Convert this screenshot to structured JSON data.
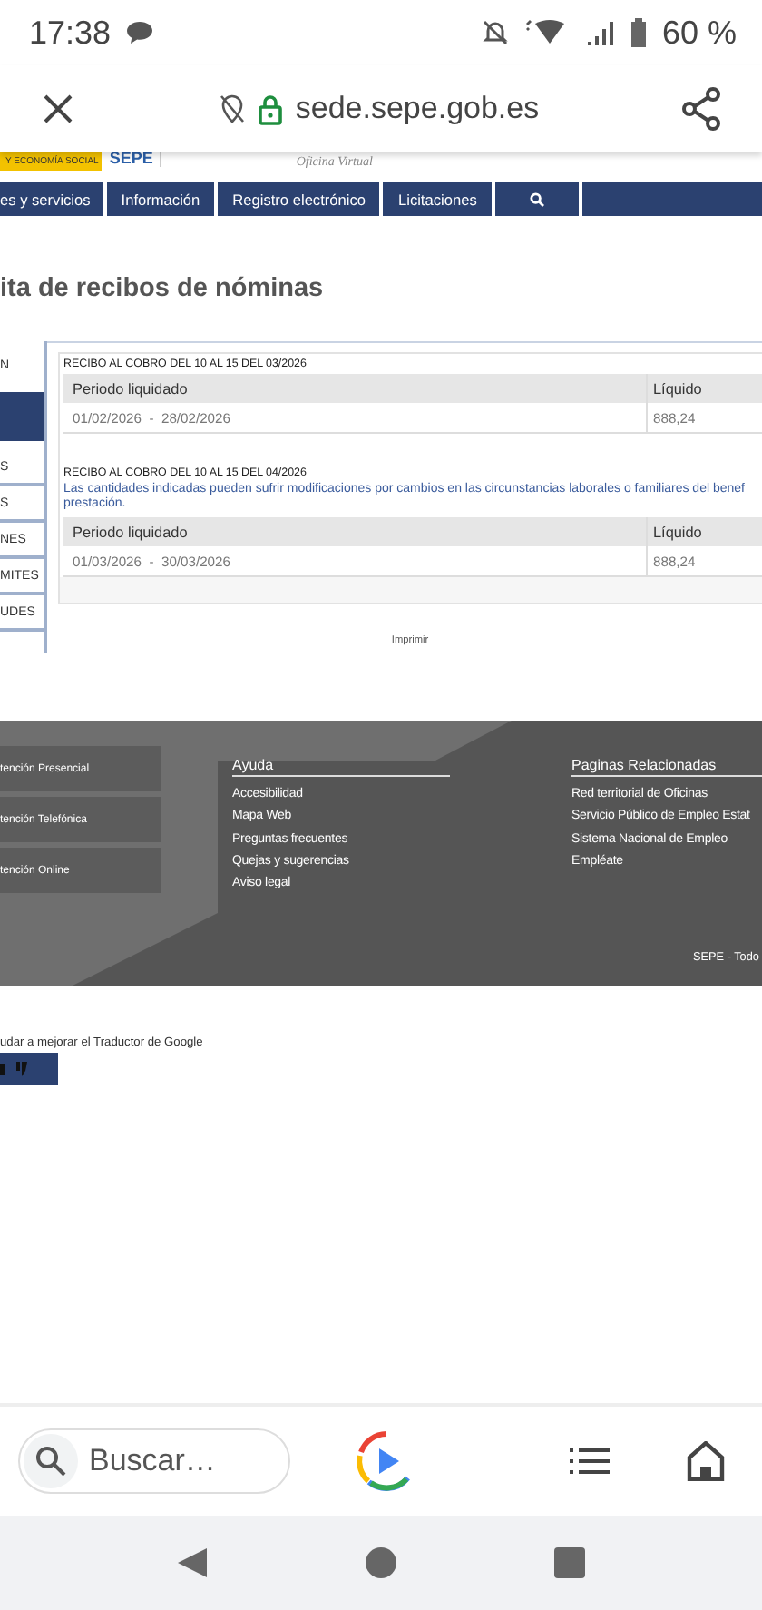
{
  "status_bar": {
    "time": "17:38",
    "battery": "60 %"
  },
  "browser": {
    "url": "sede.sepe.gob.es"
  },
  "header": {
    "ministry": "Y ECONOMÍA SOCIAL",
    "logo": "SEPE",
    "subtitle": "Oficina Virtual"
  },
  "nav": [
    {
      "kind": "text",
      "label": "es y servicios"
    },
    {
      "kind": "text",
      "label": "Información"
    },
    {
      "kind": "text",
      "label": "Registro electrónico"
    },
    {
      "kind": "text",
      "label": "Licitaciones"
    },
    {
      "kind": "search"
    }
  ],
  "page_title": "ita de recibos de nóminas",
  "sidebar": [
    {
      "label": "N",
      "selected": false
    },
    {
      "selected": true
    },
    {
      "label": "S",
      "selected": false
    },
    {
      "label": "S",
      "selected": false
    },
    {
      "label": "NES",
      "selected": false
    },
    {
      "label": "MITES",
      "selected": false
    },
    {
      "label": "UDES",
      "selected": false
    }
  ],
  "receipts": [
    {
      "heading": "RECIBO AL COBRO DEL 10 AL 15 DEL 03/2026",
      "columns": [
        "Periodo liquidado",
        "Líquido"
      ],
      "period": "01/02/2026  -  28/02/2026",
      "amount": "888,24"
    },
    {
      "heading": "RECIBO AL COBRO DEL 10 AL 15 DEL 04/2026",
      "notice_lines": [
        "Las cantidades indicadas pueden sufrir modificaciones por cambios en las circunstancias laborales o familiares del benef",
        "prestación."
      ],
      "columns": [
        "Periodo liquidado",
        "Líquido"
      ],
      "period": "01/03/2026  -  30/03/2026",
      "amount": "888,24"
    }
  ],
  "print": "Imprimir",
  "footer": {
    "contact": [
      "tención Presencial",
      "tención Telefónica",
      "tención Online"
    ],
    "columns": [
      {
        "title": "Ayuda",
        "links": [
          "Accesibilidad",
          "Mapa Web",
          "Preguntas frecuentes",
          "Quejas y sugerencias",
          "Aviso legal"
        ]
      },
      {
        "title": "Paginas Relacionadas",
        "links": [
          "Red territorial de Oficinas",
          "Servicio Público de Empleo Estat",
          "Sistema Nacional de Empleo",
          "Empléate"
        ]
      }
    ],
    "copyright": "SEPE - Todo"
  },
  "translator": {
    "text": "udar a mejorar el Traductor de Google"
  },
  "bottom_bar": {
    "search": {
      "placeholder": "Buscar…"
    }
  }
}
